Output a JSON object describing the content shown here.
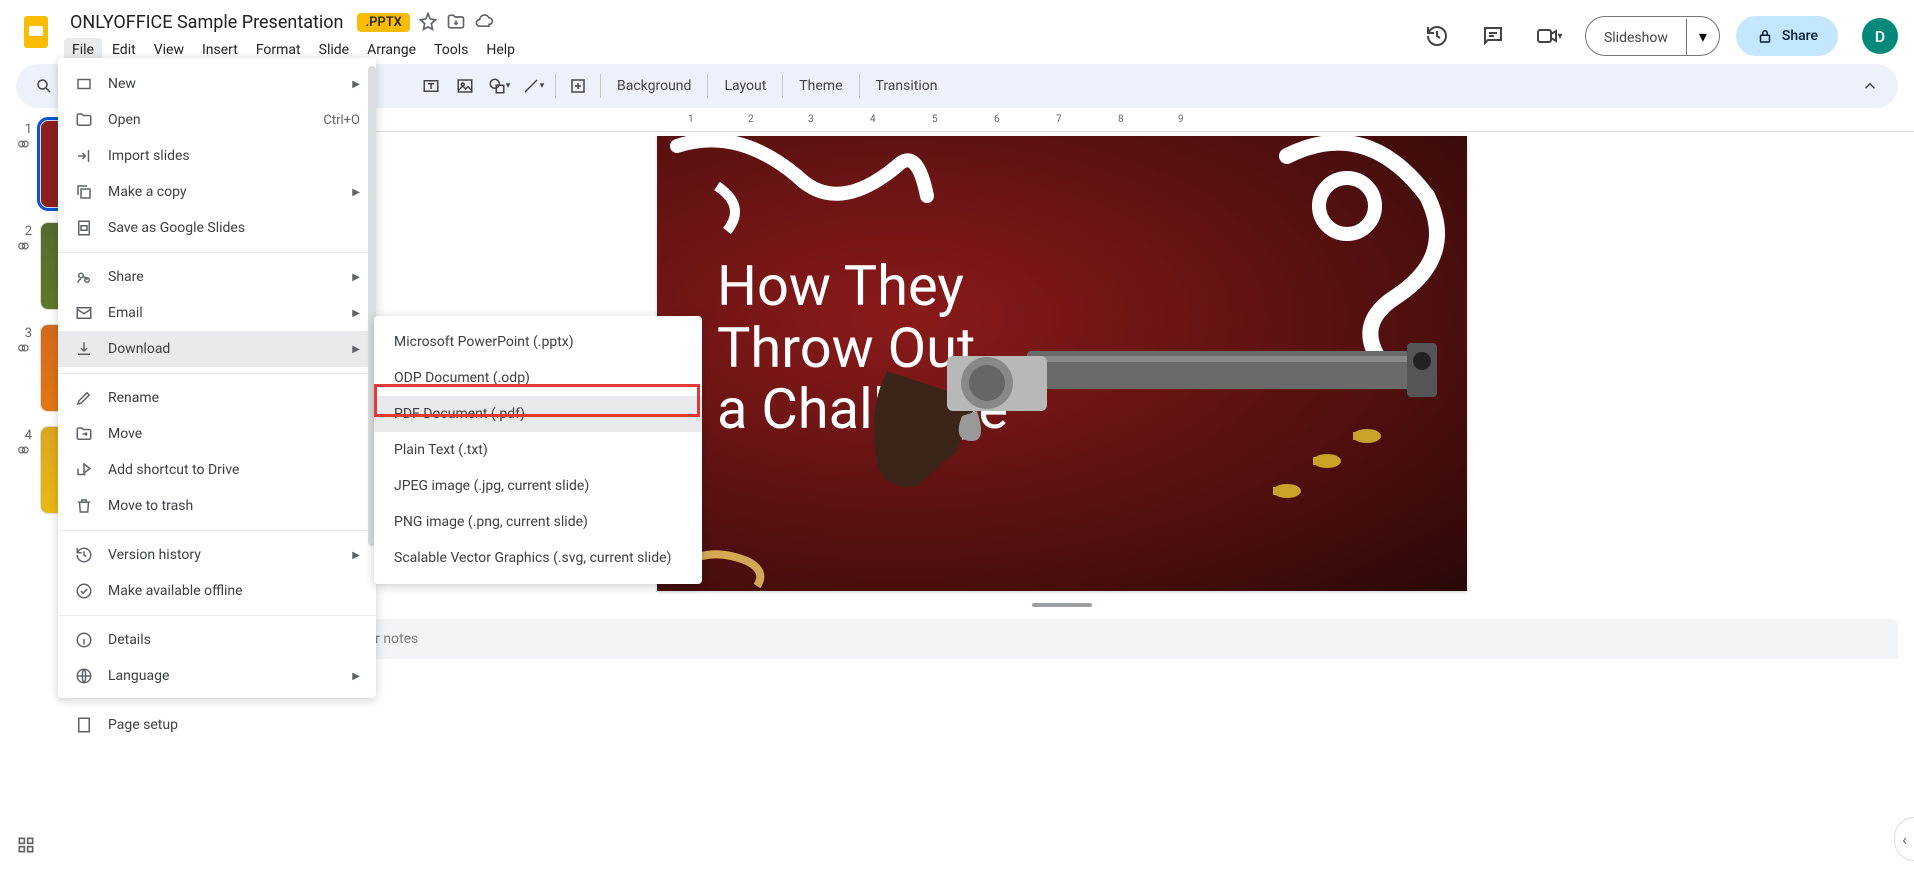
{
  "header": {
    "doc_title": "ONLYOFFICE Sample Presentation",
    "badge": ".PPTX",
    "slideshow_label": "Slideshow",
    "share_label": "Share",
    "avatar_letter": "D"
  },
  "menubar": [
    "File",
    "Edit",
    "View",
    "Insert",
    "Format",
    "Slide",
    "Arrange",
    "Tools",
    "Help"
  ],
  "toolbar": {
    "background": "Background",
    "layout": "Layout",
    "theme": "Theme",
    "transition": "Transition"
  },
  "file_menu": [
    {
      "icon": "rect",
      "label": "New",
      "arrow": true
    },
    {
      "icon": "folder",
      "label": "Open",
      "shortcut": "Ctrl+O"
    },
    {
      "icon": "import",
      "label": "Import slides"
    },
    {
      "icon": "copy",
      "label": "Make a copy",
      "arrow": true
    },
    {
      "icon": "slides",
      "label": "Save as Google Slides"
    },
    {
      "sep": true
    },
    {
      "icon": "share",
      "label": "Share",
      "arrow": true
    },
    {
      "icon": "email",
      "label": "Email",
      "arrow": true
    },
    {
      "icon": "download",
      "label": "Download",
      "arrow": true,
      "active": true
    },
    {
      "sep": true
    },
    {
      "icon": "rename",
      "label": "Rename"
    },
    {
      "icon": "move",
      "label": "Move"
    },
    {
      "icon": "shortcut",
      "label": "Add shortcut to Drive"
    },
    {
      "icon": "trash",
      "label": "Move to trash"
    },
    {
      "sep": true
    },
    {
      "icon": "history",
      "label": "Version history",
      "arrow": true
    },
    {
      "icon": "offline",
      "label": "Make available offline"
    },
    {
      "sep": true
    },
    {
      "icon": "info",
      "label": "Details"
    },
    {
      "icon": "globe",
      "label": "Language",
      "arrow": true
    },
    {
      "sep": true
    },
    {
      "icon": "page",
      "label": "Page setup"
    }
  ],
  "download_menu": [
    "Microsoft PowerPoint (.pptx)",
    "ODP Document (.odp)",
    "PDF Document (.pdf)",
    "Plain Text (.txt)",
    "JPEG image (.jpg, current slide)",
    "PNG image (.png, current slide)",
    "Scalable Vector Graphics (.svg, current slide)"
  ],
  "download_highlight_index": 2,
  "slide": {
    "title_line1": "How They",
    "title_line2": "Throw Out",
    "title_line3": "a Challenge"
  },
  "ruler_ticks": [
    "1",
    "2",
    "3",
    "4",
    "5",
    "6",
    "7",
    "8",
    "9"
  ],
  "thumbs": [
    1,
    2,
    3,
    4
  ],
  "notes_placeholder": "Click to add speaker notes"
}
